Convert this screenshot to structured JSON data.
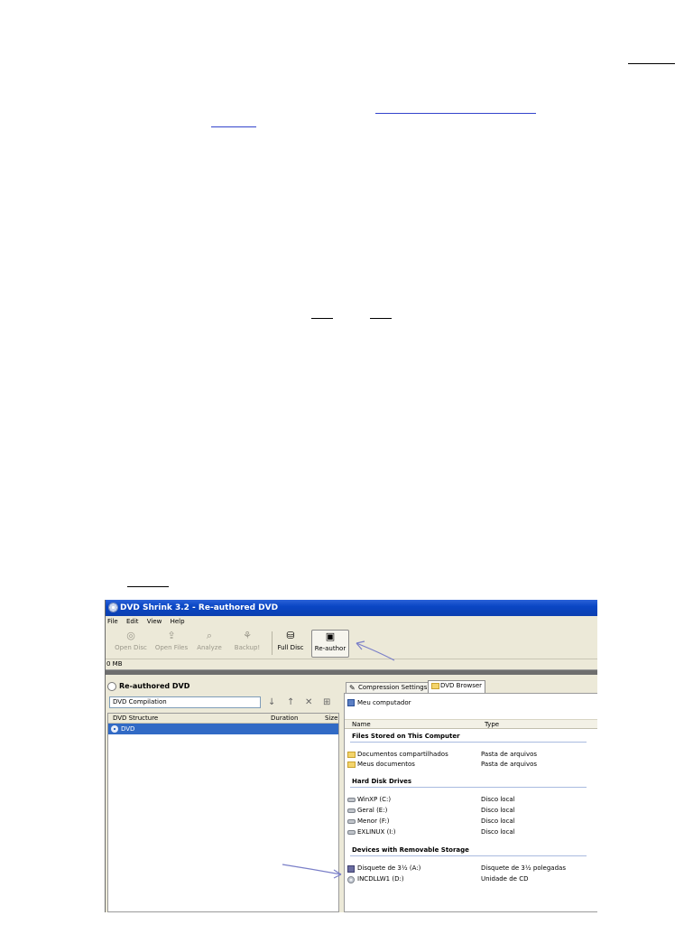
{
  "app": {
    "title": "DVD Shrink 3.2 - Re-authored DVD",
    "menu": [
      "File",
      "Edit",
      "View",
      "Help"
    ],
    "toolbar": [
      {
        "label": "Open Disc",
        "icon": "disc-icon",
        "enabled": false
      },
      {
        "label": "Open Files",
        "icon": "open-files-icon",
        "enabled": false
      },
      {
        "label": "Analyze",
        "icon": "analyze-icon",
        "enabled": false
      },
      {
        "label": "Backup!",
        "icon": "backup-icon",
        "enabled": false
      },
      {
        "label": "Full Disc",
        "icon": "full-disc-icon",
        "enabled": true
      },
      {
        "label": "Re-author",
        "icon": "re-author-icon",
        "enabled": true,
        "pressed": true
      }
    ],
    "size_label": "0 MB"
  },
  "left_panel": {
    "header": "Re-authored DVD",
    "compilation_name": "DVD Compilation",
    "columns": [
      "DVD Structure",
      "Duration",
      "Size"
    ],
    "rows": [
      {
        "name": "DVD",
        "selected": true
      }
    ]
  },
  "right_panel": {
    "tabs": [
      "Compression Settings",
      "DVD Browser"
    ],
    "active_tab": "DVD Browser",
    "address": "Meu computador",
    "columns": [
      "Name",
      "Type"
    ],
    "groups": [
      {
        "title": "Files Stored on This Computer",
        "items": [
          {
            "name": "Documentos compartilhados",
            "type": "Pasta de arquivos",
            "icon": "folder-icon"
          },
          {
            "name": "Meus documentos",
            "type": "Pasta de arquivos",
            "icon": "folder-icon"
          }
        ]
      },
      {
        "title": "Hard Disk Drives",
        "items": [
          {
            "name": "WinXP (C:)",
            "type": "Disco local",
            "icon": "drive-icon"
          },
          {
            "name": "Geral (E:)",
            "type": "Disco local",
            "icon": "drive-icon"
          },
          {
            "name": "Menor (F:)",
            "type": "Disco local",
            "icon": "drive-icon"
          },
          {
            "name": "EXLINUX (I:)",
            "type": "Disco local",
            "icon": "drive-icon"
          }
        ]
      },
      {
        "title": "Devices with Removable Storage",
        "items": [
          {
            "name": "Disquete de 3½ (A:)",
            "type": "Disquete de 3½ polegadas",
            "icon": "floppy-icon"
          },
          {
            "name": "INCDLLW1 (D:)",
            "type": "Unidade de CD",
            "icon": "cd-drive-icon"
          }
        ]
      }
    ]
  },
  "colors": {
    "titlebar": "#0a46c4",
    "selection": "#316ac5",
    "window_face": "#ece9d8",
    "annotation_arrow": "#7a7fc8",
    "link_underline": "#3344cc"
  }
}
